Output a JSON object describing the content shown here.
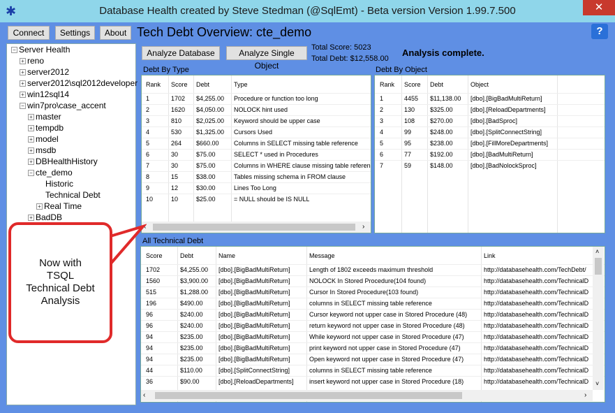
{
  "window": {
    "title": "Database Health created by Steve Stedman (@SqlEmt) - Beta version Version 1.99.7.500",
    "close": "✕"
  },
  "toolbar": {
    "connect": "Connect",
    "settings": "Settings",
    "about": "About",
    "help": "?"
  },
  "heading": "Tech Debt Overview: cte_demo",
  "tree": [
    {
      "label": "Server Health",
      "level": 0,
      "exp": "−"
    },
    {
      "label": "reno",
      "level": 1,
      "exp": "+"
    },
    {
      "label": "server2012",
      "level": 1,
      "exp": "+"
    },
    {
      "label": "server2012\\sql2012developer",
      "level": 1,
      "exp": "+"
    },
    {
      "label": "win12sql14",
      "level": 1,
      "exp": "+"
    },
    {
      "label": "win7pro\\case_accent",
      "level": 1,
      "exp": "−"
    },
    {
      "label": "master",
      "level": 2,
      "exp": "+"
    },
    {
      "label": "tempdb",
      "level": 2,
      "exp": "+"
    },
    {
      "label": "model",
      "level": 2,
      "exp": "+"
    },
    {
      "label": "msdb",
      "level": 2,
      "exp": "+"
    },
    {
      "label": "DBHealthHistory",
      "level": 2,
      "exp": "+"
    },
    {
      "label": "cte_demo",
      "level": 2,
      "exp": "−"
    },
    {
      "label": "Historic",
      "level": 3,
      "exp": ""
    },
    {
      "label": "Technical Debt",
      "level": 3,
      "exp": ""
    },
    {
      "label": "Real Time",
      "level": 3,
      "exp": "+"
    },
    {
      "label": "BadDB",
      "level": 2,
      "exp": "+"
    }
  ],
  "actions": {
    "analyze_db": "Analyze Database",
    "analyze_obj": "Analyze Single Object"
  },
  "totals": {
    "score": "Total Score: 5023",
    "debt": "Total Debt: $12,558.00"
  },
  "status": "Analysis complete.",
  "debt_by_type": {
    "label": "Debt By Type",
    "columns": [
      "Rank",
      "Score",
      "Debt",
      "Type"
    ],
    "rows": [
      [
        "1",
        "1702",
        "$4,255.00",
        "Procedure or function too long"
      ],
      [
        "2",
        "1620",
        "$4,050.00",
        "NOLOCK hint used"
      ],
      [
        "3",
        "810",
        "$2,025.00",
        "Keyword should be upper case"
      ],
      [
        "4",
        "530",
        "$1,325.00",
        "Cursors Used"
      ],
      [
        "5",
        "264",
        "$660.00",
        "Columns in SELECT missing table reference"
      ],
      [
        "6",
        "30",
        "$75.00",
        "SELECT * used in Procedures"
      ],
      [
        "7",
        "30",
        "$75.00",
        "Columns in WHERE clause missing table reference"
      ],
      [
        "8",
        "15",
        "$38.00",
        "Tables missing schema in FROM clause"
      ],
      [
        "9",
        "12",
        "$30.00",
        "Lines Too Long"
      ],
      [
        "10",
        "10",
        "$25.00",
        "= NULL should be IS NULL"
      ]
    ]
  },
  "debt_by_object": {
    "label": "Debt By Object",
    "columns": [
      "Rank",
      "Score",
      "Debt",
      "Object"
    ],
    "rows": [
      [
        "1",
        "4455",
        "$11,138.00",
        "[dbo].[BigBadMultiReturn]"
      ],
      [
        "2",
        "130",
        "$325.00",
        "[dbo].[ReloadDepartments]"
      ],
      [
        "3",
        "108",
        "$270.00",
        "[dbo].[BadSproc]"
      ],
      [
        "4",
        "99",
        "$248.00",
        "[dbo].[SplitConnectString]"
      ],
      [
        "5",
        "95",
        "$238.00",
        "[dbo].[FillMoreDepartments]"
      ],
      [
        "6",
        "77",
        "$192.00",
        "[dbo].[BadMultiReturn]"
      ],
      [
        "7",
        "59",
        "$148.00",
        "[dbo].[BadNolockSproc]"
      ]
    ]
  },
  "all_debt": {
    "label": "All Technical Debt",
    "columns": [
      "Score",
      "Debt",
      "Name",
      "Message",
      "Link"
    ],
    "rows": [
      [
        "1702",
        "$4,255.00",
        "[dbo].[BigBadMultiReturn]",
        "Length of 1802 exceeds maximum threshold",
        "http://databasehealth.com/TechDebt/"
      ],
      [
        "1560",
        "$3,900.00",
        "[dbo].[BigBadMultiReturn]",
        "NOLOCK In Stored Procedure(104 found)",
        "http://databasehealth.com/TechnicalD"
      ],
      [
        "515",
        "$1,288.00",
        "[dbo].[BigBadMultiReturn]",
        "Cursor In Stored Procedure(103 found)",
        "http://databasehealth.com/TechnicalD"
      ],
      [
        "196",
        "$490.00",
        "[dbo].[BigBadMultiReturn]",
        "columns in SELECT missing table reference",
        "http://databasehealth.com/TechnicalD"
      ],
      [
        "96",
        "$240.00",
        "[dbo].[BigBadMultiReturn]",
        "Cursor keyword not upper case in Stored Procedure (48)",
        "http://databasehealth.com/TechnicalD"
      ],
      [
        "96",
        "$240.00",
        "[dbo].[BigBadMultiReturn]",
        "return keyword not upper case in Stored Procedure (48)",
        "http://databasehealth.com/TechnicalD"
      ],
      [
        "94",
        "$235.00",
        "[dbo].[BigBadMultiReturn]",
        "While keyword not upper case in Stored Procedure (47)",
        "http://databasehealth.com/TechnicalD"
      ],
      [
        "94",
        "$235.00",
        "[dbo].[BigBadMultiReturn]",
        "print keyword not upper case in Stored Procedure (47)",
        "http://databasehealth.com/TechnicalD"
      ],
      [
        "94",
        "$235.00",
        "[dbo].[BigBadMultiReturn]",
        "Open keyword not upper case in Stored Procedure (47)",
        "http://databasehealth.com/TechnicalD"
      ],
      [
        "44",
        "$110.00",
        "[dbo].[SplitConnectString]",
        "columns in SELECT missing table reference",
        "http://databasehealth.com/TechnicalD"
      ],
      [
        "36",
        "$90.00",
        "[dbo].[ReloadDepartments]",
        "insert keyword not upper case in Stored Procedure (18)",
        "http://databasehealth.com/TechnicalD"
      ]
    ]
  },
  "callout": {
    "lines": [
      "Now with",
      "TSQL",
      "Technical Debt",
      "Analysis"
    ]
  },
  "colors": {
    "titlebar": "#8fd6ea",
    "background": "#5f8fe4",
    "callout_border": "#e02a2a"
  }
}
